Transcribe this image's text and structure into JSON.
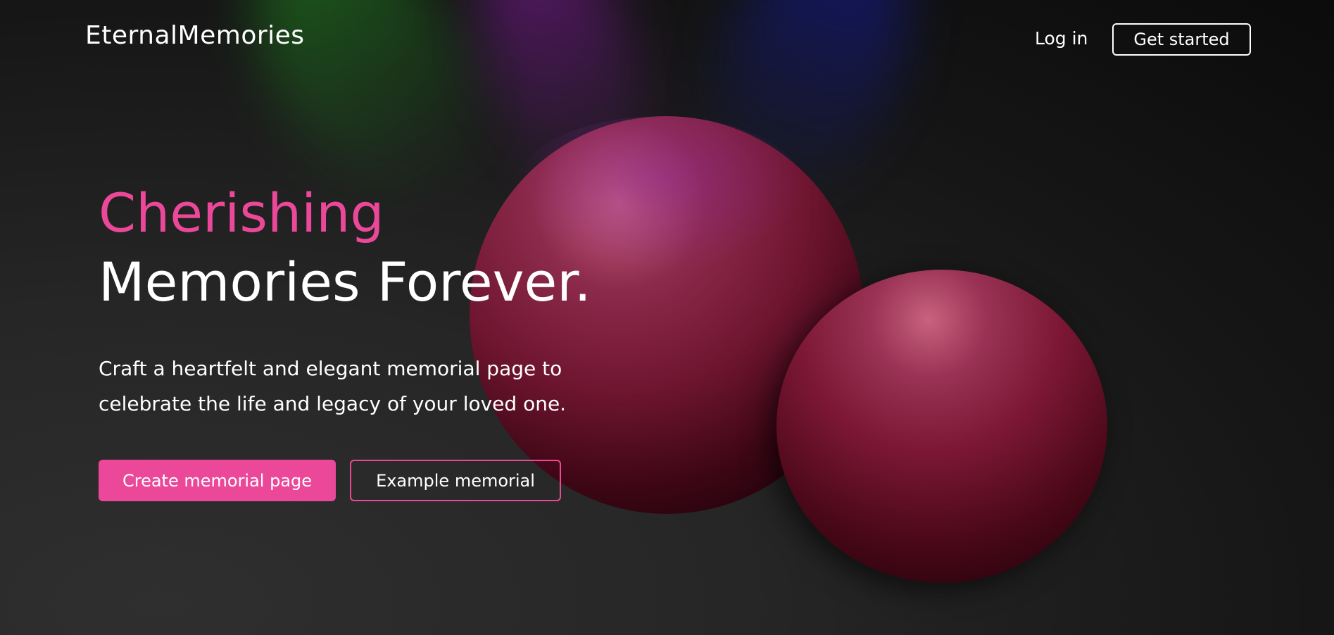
{
  "nav": {
    "brand": "EternalMemories",
    "login_label": "Log in",
    "get_started_label": "Get started"
  },
  "hero": {
    "headline_accent": "Cherishing",
    "headline_main": "Memories Forever.",
    "subtitle": "Craft a heartfelt and elegant memorial page to celebrate the life and legacy of your loved one.",
    "primary_cta": "Create memorial page",
    "secondary_cta": "Example memorial"
  },
  "colors": {
    "accent": "#ec4899",
    "background": "#1c1c1c",
    "sphere": "#7b1735"
  }
}
